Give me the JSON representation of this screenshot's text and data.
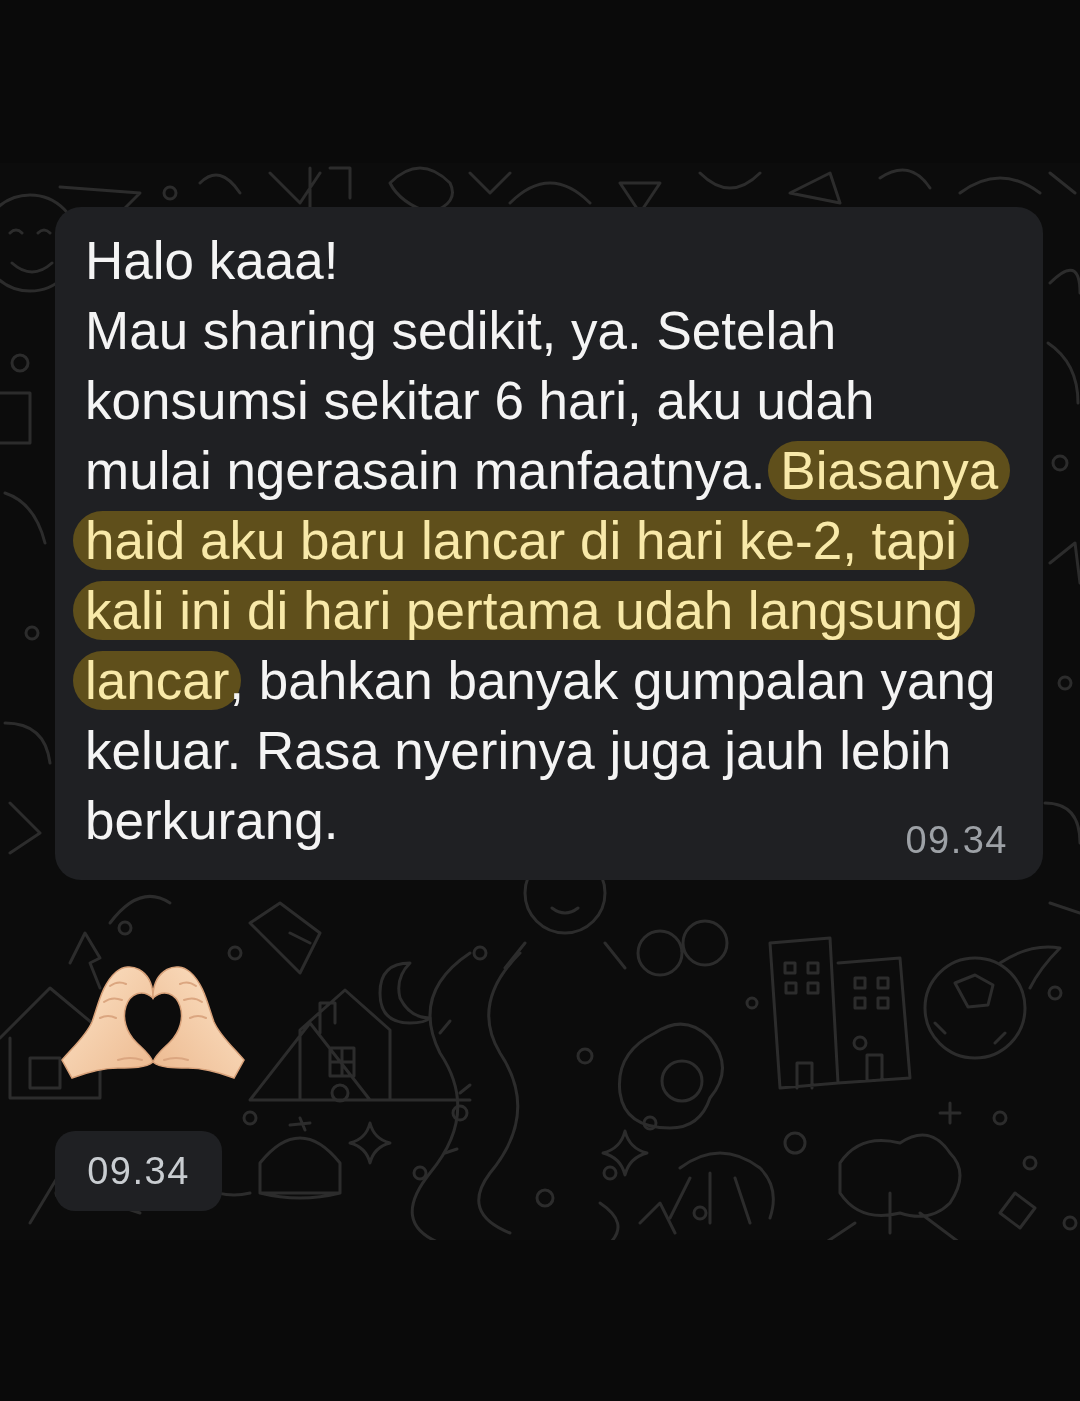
{
  "chat": {
    "messages": [
      {
        "kind": "text",
        "segments": [
          {
            "text": "Halo kaaa!\nMau sharing sedikit, ya. Setelah konsumsi sekitar 6 hari, aku udah mulai ngerasain manfaatnya. ",
            "highlighted": false
          },
          {
            "text": "Biasanya haid aku baru lancar di hari ke-2, tapi kali ini di hari pertama udah langsung lancar",
            "highlighted": true
          },
          {
            "text": ", bahkan banyak gumpalan yang keluar. Rasa nyerinya juga jauh lebih berkurang.",
            "highlighted": false
          }
        ],
        "time": "09.34"
      },
      {
        "kind": "emoji",
        "time": "09.34"
      }
    ]
  }
}
